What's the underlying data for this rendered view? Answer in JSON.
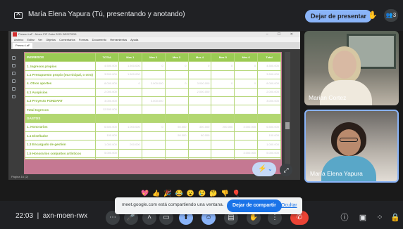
{
  "topbar": {
    "title": "María Elena Yapura (Tú, presentando y anotando)",
    "stop_presenting": "Dejar de presentar",
    "people_count": "3"
  },
  "window": {
    "title": "Pressu LaF - Moen PIF Calor 2021 BZ22T0D5",
    "menu": [
      "Archivo",
      "Editar",
      "Ver",
      "Objetos",
      "Comentarios",
      "Formas",
      "Documento",
      "Herramientas",
      "Ayuda"
    ],
    "tab": "Pressu LaF",
    "status": "Página 16 (2)"
  },
  "table": {
    "headers": [
      "INGRESOS",
      "TOTAL",
      "Mes 1",
      "Mes 2",
      "Mes 3",
      "Mes 4",
      "Mes 5",
      "Mes 6",
      "Total"
    ],
    "rows": [
      {
        "label": "1. Ingresos propios",
        "cells": [
          "4.500.000",
          "1.500.000",
          "0",
          "0",
          "0",
          "0",
          "0",
          "4.500.000"
        ]
      },
      {
        "label": "1.1 Presupuesto propio (mu-nicipal, o otro)",
        "cells": [
          "3.500.000",
          "1.500.000",
          "",
          "",
          "",
          "",
          "",
          "3.500.000"
        ]
      },
      {
        "label": "4. Otros aportes",
        "cells": [
          "8.000.000",
          "0",
          "3.000.000",
          "0",
          "3.000.000",
          "0",
          "0",
          "8.000.000"
        ]
      },
      {
        "label": "4.1 Auspicios",
        "cells": [
          "2.000.000",
          "",
          "",
          "",
          "2.000.000",
          "",
          "",
          "2.000.000"
        ]
      },
      {
        "label": "4.3 Proyecto FONDART",
        "cells": [
          "3.000.000",
          "",
          "3.000.000",
          "",
          "",
          "",
          "",
          "3.000.000"
        ]
      },
      {
        "label": "Total Ingresos",
        "cells": [
          "12.500.000",
          "",
          "",
          "",
          "",
          "",
          "",
          ""
        ]
      }
    ],
    "section": "GASTOS",
    "rows2": [
      {
        "label": "1. Honorarios",
        "cells": [
          "6.500.000",
          "1.000.000",
          "0",
          "50.000",
          "300.000",
          "200.000",
          "3.000.000",
          "6.500.000"
        ]
      },
      {
        "label": "1.1 Diseñador",
        "cells": [
          "100.000",
          "",
          "",
          "50.000",
          "80.000",
          "",
          "",
          "100.000"
        ]
      },
      {
        "label": "1.3 Encargado de gestión",
        "cells": [
          "1.000.000",
          "200.000",
          "",
          "",
          "",
          "",
          "",
          "1.000.000"
        ]
      },
      {
        "label": "1.5 Honorarios conjuntos artísticos",
        "cells": [
          "5.000.000",
          "",
          "",
          "",
          "",
          "",
          "3.000.000",
          "5.000.000"
        ]
      },
      {
        "label": "",
        "cells": [
          "",
          "",
          "",
          "",
          "",
          "",
          "",
          ""
        ]
      }
    ]
  },
  "participants": [
    {
      "name": "Marian Cortez"
    },
    {
      "name": "María Elena Yapura"
    }
  ],
  "reactions": "💖👍🎉😂😮😢🤔👎🎈",
  "bottombar": {
    "time": "22:03",
    "meeting_code": "axn-moen-rwx"
  },
  "toast": {
    "text": "meet.google.com está compartiendo una ventana.",
    "share_stop": "Dejar de compartir",
    "hide": "Ocultar"
  }
}
